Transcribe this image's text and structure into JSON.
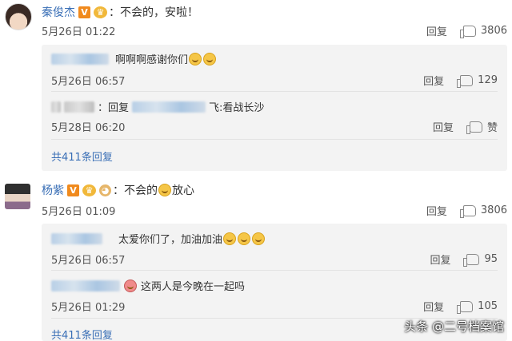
{
  "comments": [
    {
      "user": "秦俊杰",
      "text": "：不会的，安啦！",
      "date": "5月26日 01:22",
      "reply_label": "回复",
      "likes": "3806",
      "subs": [
        {
          "text": "啊啊啊感谢你们",
          "date": "5月26日 06:57",
          "reply_label": "回复",
          "likes": "129"
        },
        {
          "prefix": "：回复",
          "suffix": "飞:看战长沙",
          "date": "5月28日 06:20",
          "reply_label": "回复",
          "likes": "赞"
        }
      ],
      "total": "共411条回复"
    },
    {
      "user": "杨紫",
      "text_a": "：不会的",
      "text_b": "放心",
      "date": "5月26日 01:09",
      "reply_label": "回复",
      "likes": "3806",
      "subs": [
        {
          "text": "太爱你们了，加油加油",
          "date": "5月26日 06:57",
          "reply_label": "回复",
          "likes": "95"
        },
        {
          "text": "这两人是今晚在一起吗",
          "date": "5月26日 01:29",
          "reply_label": "回复",
          "likes": "105"
        }
      ],
      "total": "共411条回复"
    }
  ],
  "watermark": "头条 @二号档案馆",
  "colors": {
    "username": "#3a6fb6",
    "sub_bg": "#f3f3f3",
    "vip_badge": "#f08a1d"
  }
}
